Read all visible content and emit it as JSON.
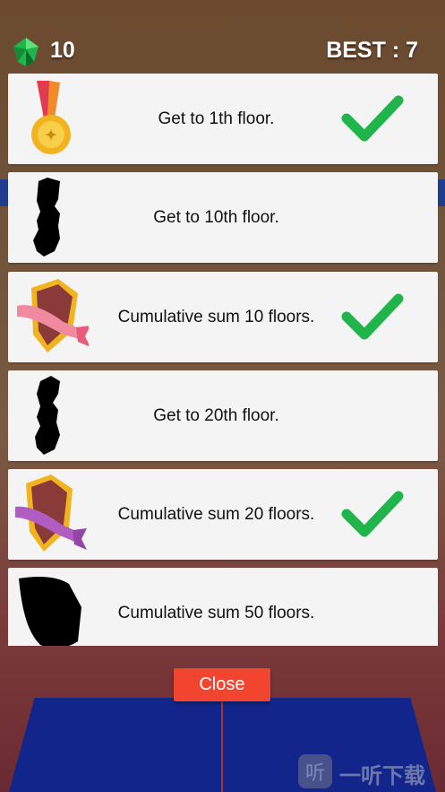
{
  "header": {
    "gem_icon": "green-gem-icon",
    "gems": "10",
    "best": "BEST : 7"
  },
  "achievements": [
    {
      "label": "Get to 1th floor.",
      "icon": "gold-medal-icon",
      "completed": true
    },
    {
      "label": "Get to 10th floor.",
      "icon": "locked-silhouette-icon",
      "completed": false
    },
    {
      "label": "Cumulative sum 10 floors.",
      "icon": "shield-pink-ribbon-icon",
      "completed": true
    },
    {
      "label": "Get to 20th floor.",
      "icon": "locked-silhouette-icon",
      "completed": false
    },
    {
      "label": "Cumulative sum 20 floors.",
      "icon": "shield-purple-ribbon-icon",
      "completed": true
    },
    {
      "label": "Cumulative sum 50 floors.",
      "icon": "locked-shield-silhouette-icon",
      "completed": false
    }
  ],
  "close_label": "Close",
  "watermark": {
    "glyph": "听",
    "text": "一听下载"
  },
  "colors": {
    "check": "#1fb54a",
    "close_button": "#f2452f",
    "card": "#f4f4f4"
  }
}
